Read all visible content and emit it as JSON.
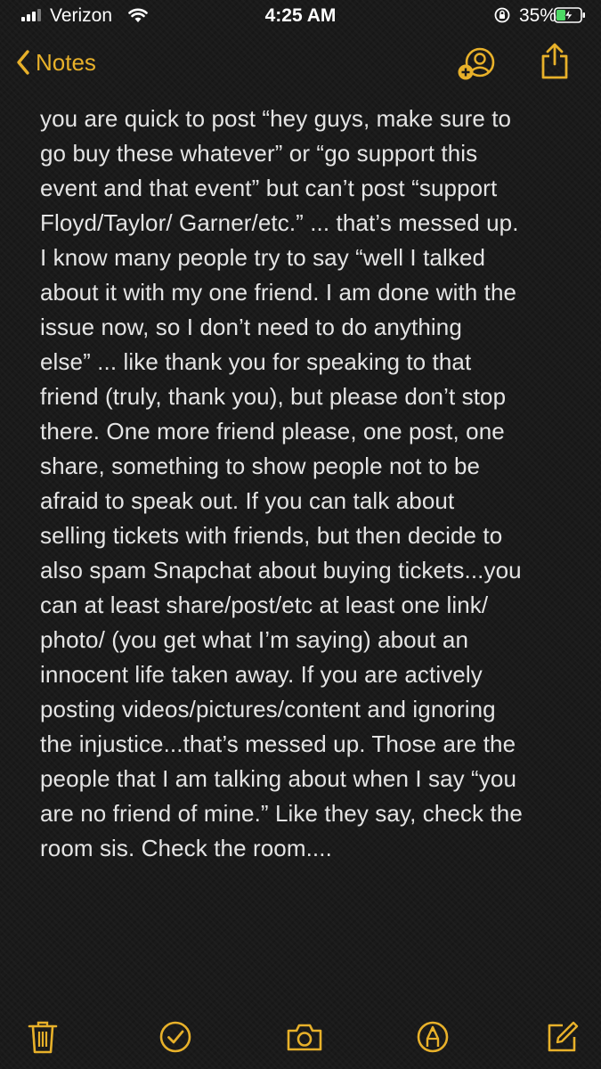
{
  "status_bar": {
    "carrier": "Verizon",
    "time": "4:25 AM",
    "battery_percent": "35%"
  },
  "nav": {
    "back_label": "Notes",
    "icons": [
      "add-person-icon",
      "share-icon"
    ]
  },
  "note": {
    "lines": [
      "you are quick to post “hey guys, make sure to",
      "go buy these whatever” or “go support this",
      "event and that event” but can’t post “support",
      "Floyd/Taylor/ Garner/etc.” ... that’s messed up.",
      "I know many people try to say “well I talked",
      "about it with my one friend. I am done with the",
      "issue now, so I don’t need to do anything",
      "else” ... like thank you for speaking to that",
      "friend (truly, thank you), but please don’t stop",
      "there. One more friend please, one post, one",
      "share, something to show people not to be",
      "afraid to speak out. If you can talk about",
      "selling tickets with friends, but then decide to",
      "also spam Snapchat about buying tickets...you",
      "can at least share/post/etc at least one link/",
      "photo/ (you get what I’m saying) about an",
      "innocent life taken away. If you are actively",
      "posting videos/pictures/content and ignoring",
      "the injustice...that’s messed up. Those are the",
      "people that I am talking about when I say “you",
      "are no friend of mine.” Like they say, check the",
      "room sis. Check the room...."
    ]
  },
  "toolbar": {
    "icons": [
      "trash-icon",
      "checklist-icon",
      "camera-icon",
      "markup-icon",
      "compose-icon"
    ]
  },
  "colors": {
    "accent": "#e8b12a",
    "background": "#1a1a1a",
    "text": "#e4e4e4",
    "battery_charging": "#4cd964"
  }
}
